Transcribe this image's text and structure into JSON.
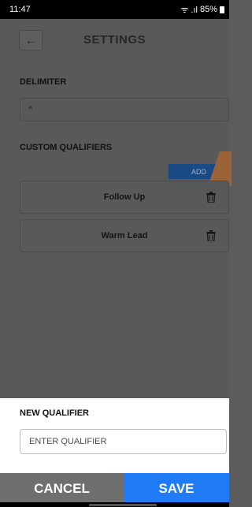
{
  "status_bar": {
    "time": "11:47",
    "signal": "ᯤ .ıl",
    "battery": "85%"
  },
  "header": {
    "back_icon": "←",
    "title": "SETTINGS"
  },
  "delimiter": {
    "label": "DELIMITER",
    "value": "^"
  },
  "custom_qualifiers": {
    "label": "CUSTOM QUALIFIERS",
    "add_label": "ADD",
    "items": [
      {
        "name": "Follow Up"
      },
      {
        "name": "Warm Lead"
      }
    ]
  },
  "new_qualifier": {
    "label": "NEW QUALIFIER",
    "placeholder": "ENTER QUALIFIER",
    "value": ""
  },
  "footer": {
    "cancel_label": "CANCEL",
    "save_label": "SAVE"
  },
  "icons": {
    "back": "arrow-left-icon",
    "delete": "trash-icon",
    "battery": "battery-icon",
    "wifi": "wifi-icon"
  },
  "colors": {
    "save": "#1f7cf6",
    "cancel": "#6f6f6f",
    "add": "#1a4a86",
    "overlay": "#595959"
  }
}
